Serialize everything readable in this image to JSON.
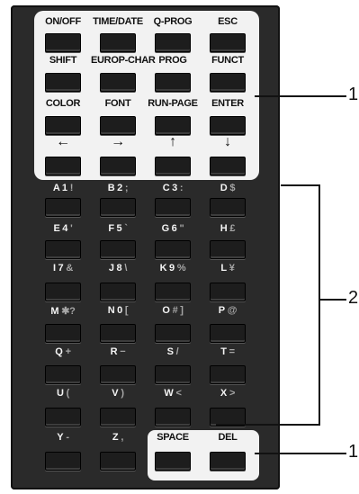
{
  "function_rows": [
    {
      "labels": [
        {
          "text": "ON/OFF"
        },
        {
          "text": "TIME/DATE"
        },
        {
          "text": "Q-PROG"
        },
        {
          "text": "ESC"
        }
      ]
    },
    {
      "labels": [
        {
          "text": "SHIFT"
        },
        {
          "text": "EUROP-CHAR"
        },
        {
          "text": "PROG"
        },
        {
          "text": "FUNCT"
        }
      ]
    },
    {
      "labels": [
        {
          "text": "COLOR"
        },
        {
          "text": "FONT"
        },
        {
          "text": "RUN-PAGE"
        },
        {
          "text": "ENTER"
        }
      ]
    },
    {
      "labels": [
        {
          "text": "←",
          "icon": "arrow-left-icon"
        },
        {
          "text": "→",
          "icon": "arrow-right-icon"
        },
        {
          "text": "↑",
          "icon": "arrow-up-icon"
        },
        {
          "text": "↓",
          "icon": "arrow-down-icon"
        }
      ]
    }
  ],
  "char_rows": [
    {
      "keys": [
        {
          "main": "A 1",
          "alt": "!"
        },
        {
          "main": "B 2",
          "alt": ";"
        },
        {
          "main": "C 3",
          "alt": ":"
        },
        {
          "main": "D",
          "alt": "$"
        }
      ]
    },
    {
      "keys": [
        {
          "main": "E 4",
          "alt": "'"
        },
        {
          "main": "F 5",
          "alt": "`"
        },
        {
          "main": "G 6",
          "alt": "\""
        },
        {
          "main": "H",
          "alt": "£"
        }
      ]
    },
    {
      "keys": [
        {
          "main": "I 7",
          "alt": "&"
        },
        {
          "main": "J 8",
          "alt": "\\"
        },
        {
          "main": "K 9",
          "alt": "%"
        },
        {
          "main": "L",
          "alt": "¥"
        }
      ]
    },
    {
      "keys": [
        {
          "main": "M",
          "alt": "✱?"
        },
        {
          "main": "N 0",
          "alt": "["
        },
        {
          "main": "O",
          "alt": "# ]"
        },
        {
          "main": "P",
          "alt": "@"
        }
      ]
    },
    {
      "keys": [
        {
          "main": "Q",
          "alt": "+"
        },
        {
          "main": "R",
          "alt": "−"
        },
        {
          "main": "S",
          "alt": "/"
        },
        {
          "main": "T",
          "alt": "="
        }
      ]
    },
    {
      "keys": [
        {
          "main": "U",
          "alt": "("
        },
        {
          "main": "V",
          "alt": ")"
        },
        {
          "main": "W",
          "alt": "<"
        },
        {
          "main": "X",
          "alt": ">"
        }
      ]
    },
    {
      "keys": [
        {
          "main": "Y",
          "alt": "-"
        },
        {
          "main": "Z",
          "alt": ","
        },
        {
          "main": "SPACE",
          "alt": ""
        },
        {
          "main": "DEL",
          "alt": ""
        }
      ]
    }
  ],
  "callouts": {
    "one_top": "1",
    "two": "2",
    "one_bottom": "1"
  },
  "colors": {
    "body": "#2a2a2a",
    "panel": "#f2f2f2",
    "key": "#1d1d1d",
    "alt_symbol": "#a6a6a6"
  }
}
